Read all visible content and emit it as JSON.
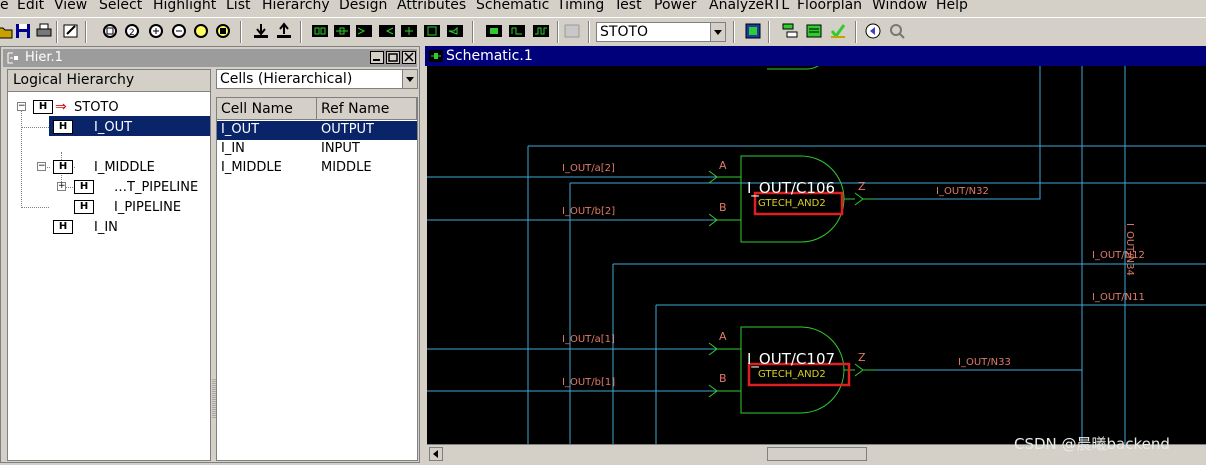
{
  "menu": [
    "e",
    "Edit",
    "View",
    "Select",
    "Highlight",
    "List",
    "Hierarchy",
    "Design",
    "Attributes",
    "Schematic",
    "Timing",
    "Test",
    "Power",
    "AnalyzeRTL",
    "Floorplan",
    "Window",
    "Help"
  ],
  "toolbar": {
    "design_select": "STOTO"
  },
  "hier": {
    "title": "Hier.1",
    "pane_header": "Logical Hierarchy",
    "tree": {
      "root": "STOTO",
      "i_out": "I_OUT",
      "i_middle": "I_MIDDLE",
      "t_pipeline": "…T_PIPELINE",
      "i_pipeline": "I_PIPELINE",
      "i_in": "I_IN",
      "badge": "H"
    },
    "cells_combo": "Cells (Hierarchical)",
    "columns": [
      "Cell Name",
      "Ref Name"
    ],
    "rows": [
      {
        "cell": "I_OUT",
        "ref": "OUTPUT"
      },
      {
        "cell": "I_IN",
        "ref": "INPUT"
      },
      {
        "cell": "I_MIDDLE",
        "ref": "MIDDLE"
      }
    ]
  },
  "schematic": {
    "title": "Schematic.1",
    "gate1": {
      "name": "I_OUT/C106",
      "type": "GTECH_AND2",
      "pin_a": "A",
      "pin_b": "B",
      "pin_z": "Z",
      "in_a": "I_OUT/a[2]",
      "in_b": "I_OUT/b[2]",
      "out": "I_OUT/N32"
    },
    "gate2": {
      "name": "I_OUT/C107",
      "type": "GTECH_AND2",
      "pin_a": "A",
      "pin_b": "B",
      "pin_z": "Z",
      "in_a": "I_OUT/a[1]",
      "in_b": "I_OUT/b[1]",
      "out": "I_OUT/N33"
    },
    "net_n12": "I_OUT/N12",
    "net_n11": "I_OUT/N11",
    "net_n34": "I_OUT/N34"
  },
  "watermark": "CSDN @晨曦backend",
  "colors": {
    "wire": "#3fa9d6",
    "gate": "#2fcc2f",
    "label": "#e07a6a",
    "highlight": "#e02020",
    "selection": "#0a246a"
  }
}
